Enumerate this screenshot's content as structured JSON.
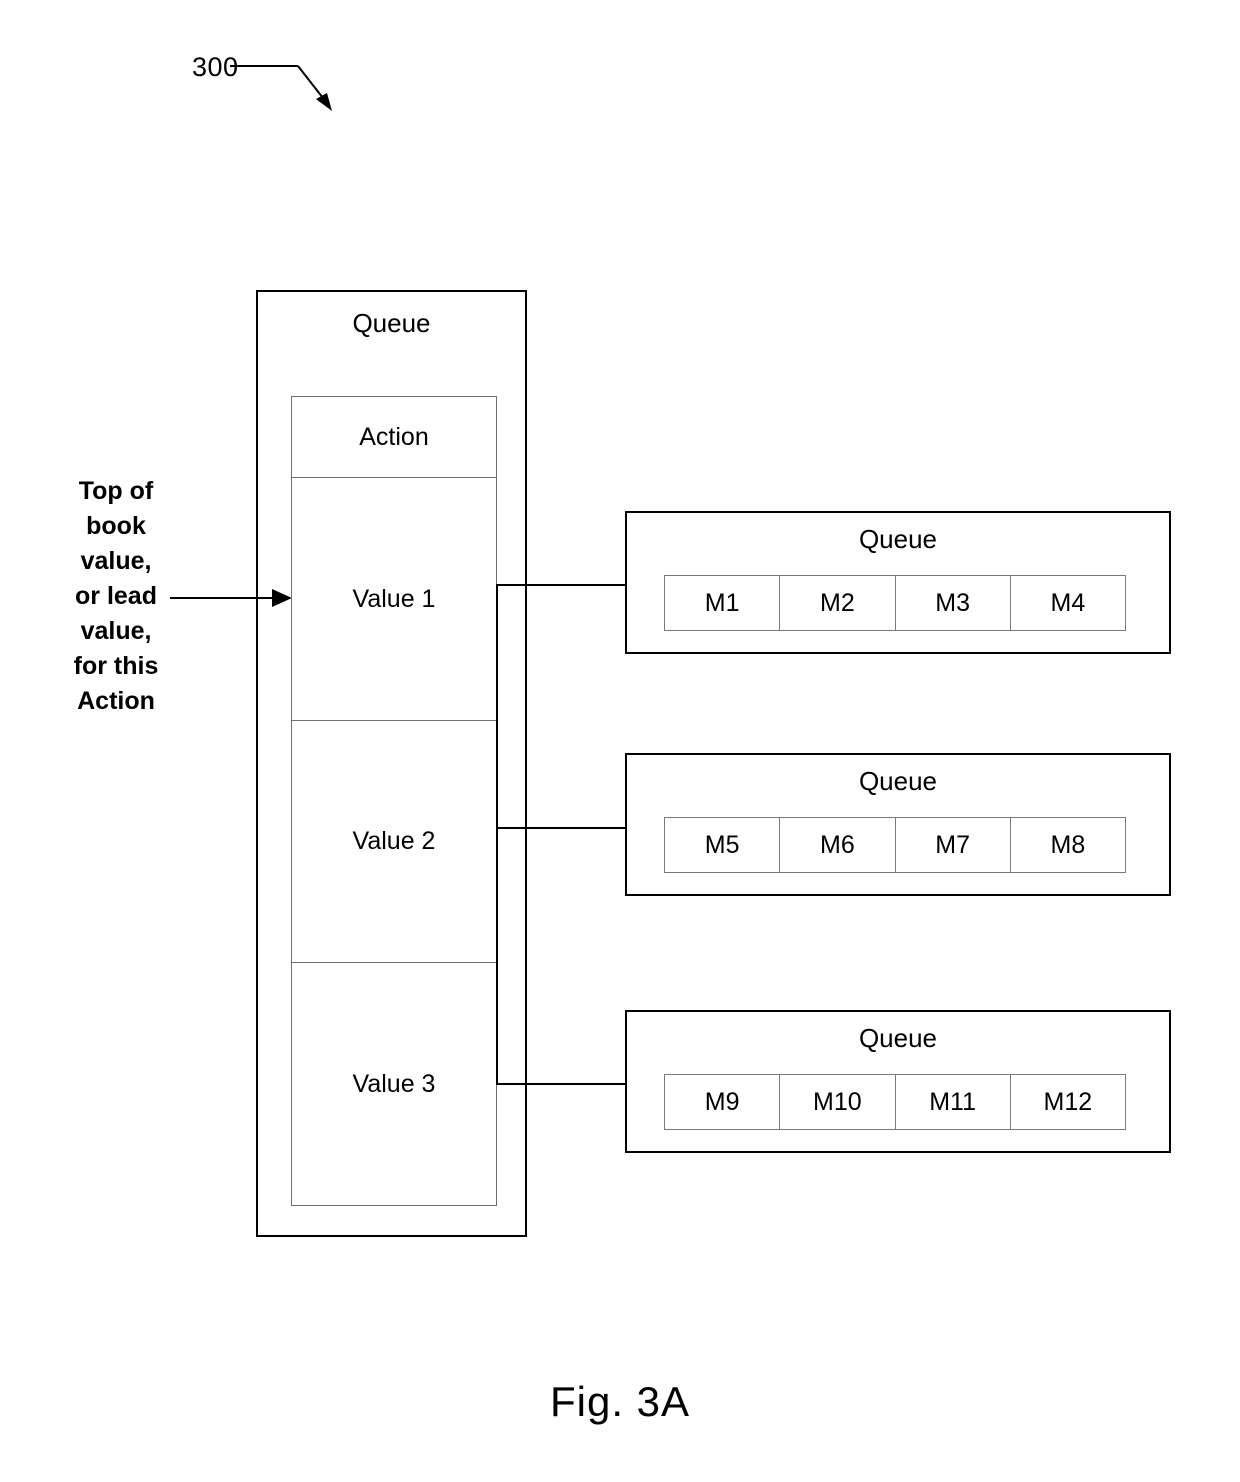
{
  "figure": {
    "reference_number": "300",
    "caption": "Fig. 3A"
  },
  "annotation": {
    "left_label": "Top of\nbook\nvalue,\nor lead\nvalue,\nfor this\nAction"
  },
  "main_queue": {
    "title": "Queue",
    "rows": [
      {
        "label": "Action"
      },
      {
        "label": "Value 1"
      },
      {
        "label": "Value 2"
      },
      {
        "label": "Value 3"
      }
    ]
  },
  "sub_queues": [
    {
      "title": "Queue",
      "messages": [
        "M1",
        "M2",
        "M3",
        "M4"
      ]
    },
    {
      "title": "Queue",
      "messages": [
        "M5",
        "M6",
        "M7",
        "M8"
      ]
    },
    {
      "title": "Queue",
      "messages": [
        "M9",
        "M10",
        "M11",
        "M12"
      ]
    }
  ],
  "colors": {
    "stroke": "#000000",
    "inner_stroke": "#6f6f6f",
    "background": "#ffffff"
  }
}
